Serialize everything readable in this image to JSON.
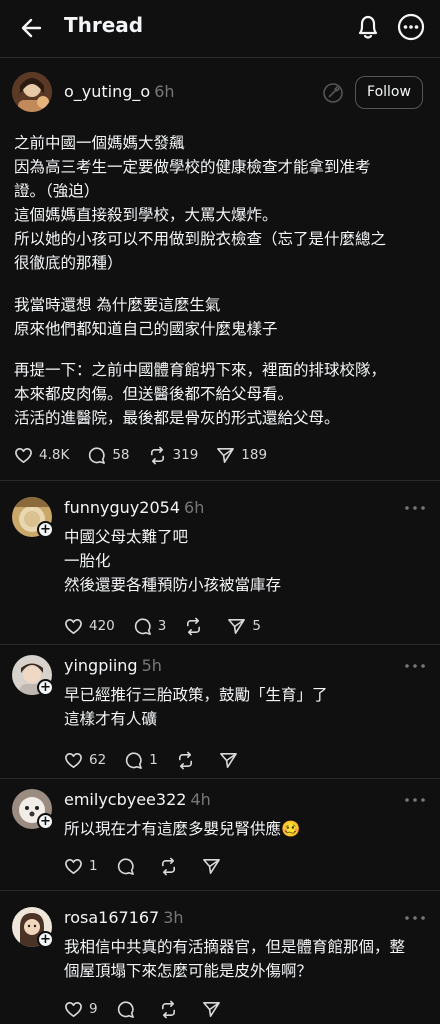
{
  "header": {
    "title": "Thread"
  },
  "post": {
    "username": "o_yuting_o",
    "time": "6h",
    "follow_label": "Follow",
    "paragraphs": [
      [
        "之前中國一個媽媽大發飆",
        "因為高三考生一定要做學校的健康檢查才能拿到准考",
        "證。（強迫）",
        "這個媽媽直接殺到學校，大罵大爆炸。",
        "所以她的小孩可以不用做到脫衣檢查（忘了是什麼總之",
        "很徹底的那種）"
      ],
      [
        "我當時還想 為什麼要這麼生氣",
        "原來他們都知道自己的國家什麼鬼樣子"
      ],
      [
        "再提一下：之前中國體育館坍下來，裡面的排球校隊，",
        "本來都皮肉傷。但送醫後都不給父母看。",
        "活活的進醫院，最後都是骨灰的形式還給父母。"
      ]
    ],
    "likes": "4.8K",
    "replies": "58",
    "reposts": "319",
    "shares": "189"
  },
  "comments": [
    {
      "username": "funnyguy2054",
      "time": "6h",
      "lines": [
        "中國父母太難了吧",
        "一胎化",
        "然後還要各種預防小孩被當庫存"
      ],
      "likes": "420",
      "replies": "3",
      "reposts": "",
      "shares": "5"
    },
    {
      "username": "yingpiing",
      "time": "5h",
      "lines": [
        "早已經推行三胎政策，鼓勵「生育」了",
        "這樣才有人礦"
      ],
      "likes": "62",
      "replies": "1",
      "reposts": "",
      "shares": ""
    },
    {
      "username": "emilycbyee322",
      "time": "4h",
      "lines": [
        "所以現在才有這麼多嬰兒腎供應🥴"
      ],
      "likes": "1",
      "replies": "",
      "reposts": "",
      "shares": ""
    },
    {
      "username": "rosa167167",
      "time": "3h",
      "lines": [
        "我相信中共真的有活摘器官，但是體育館那個，整",
        "個屋頂塌下來怎麼可能是皮外傷啊？"
      ],
      "likes": "9",
      "replies": "",
      "reposts": "",
      "shares": ""
    }
  ],
  "icons": {
    "back": "arrow-left-icon",
    "notifications": "bell-icon",
    "more": "more-circle-icon",
    "like": "heart-icon",
    "reply": "comment-icon",
    "repost": "repost-icon",
    "share": "send-icon",
    "add": "plus-icon"
  },
  "colors": {
    "background": "#101010",
    "text": "#f3f5f7",
    "muted": "#777777",
    "divider": "#2a2a2a"
  }
}
